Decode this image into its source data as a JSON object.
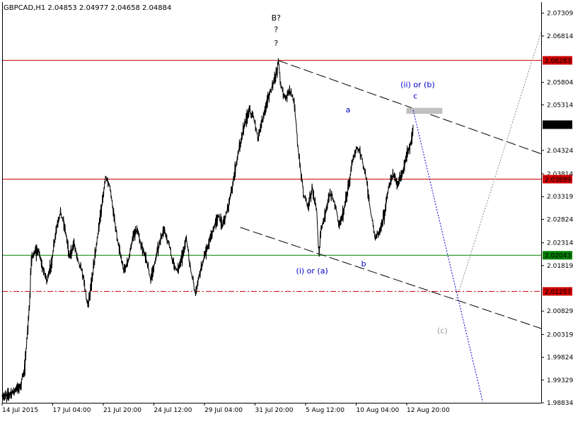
{
  "chart_data": {
    "type": "line",
    "title": "GBPCAD,H1  2.04853 2.04977 2.04658 2.04884",
    "xlabel": "",
    "ylabel": "",
    "ylim": [
      1.98834,
      2.0755
    ],
    "y_ticks": [
      "2.07309",
      "2.06814",
      "2.05804",
      "2.05314",
      "2.04324",
      "2.03814",
      "2.03319",
      "2.02824",
      "2.02314",
      "2.01819",
      "2.00829",
      "2.00319",
      "1.99824",
      "1.99329",
      "1.98834"
    ],
    "x_ticks": [
      "14 Jul 2015",
      "17 Jul 04:00",
      "21 Jul 20:00",
      "24 Jul 12:00",
      "29 Jul 04:00",
      "31 Jul 20:00",
      "5 Aug 12:00",
      "10 Aug 04:00",
      "12 Aug 20:00"
    ],
    "price_path": [
      [
        0,
        1.9895
      ],
      [
        2,
        1.9905
      ],
      [
        4,
        1.992
      ],
      [
        5,
        1.996
      ],
      [
        6,
        2.0085
      ],
      [
        6.5,
        2.02
      ],
      [
        8,
        2.0215
      ],
      [
        9,
        2.0175
      ],
      [
        10,
        2.015
      ],
      [
        11,
        2.019
      ],
      [
        12,
        2.026
      ],
      [
        13,
        2.03
      ],
      [
        14,
        2.026
      ],
      [
        15,
        2.02
      ],
      [
        16,
        2.023
      ],
      [
        17,
        2.019
      ],
      [
        18,
        2.016
      ],
      [
        19,
        2.0095
      ],
      [
        20,
        2.015
      ],
      [
        21,
        2.023
      ],
      [
        22,
        2.03
      ],
      [
        23,
        2.0375
      ],
      [
        24,
        2.035
      ],
      [
        25,
        2.028
      ],
      [
        26,
        2.022
      ],
      [
        27,
        2.017
      ],
      [
        28,
        2.019
      ],
      [
        29,
        2.024
      ],
      [
        30,
        2.026
      ],
      [
        31,
        2.022
      ],
      [
        32,
        2.02
      ],
      [
        33,
        2.015
      ],
      [
        34,
        2.019
      ],
      [
        35,
        2.023
      ],
      [
        36,
        2.026
      ],
      [
        37,
        2.023
      ],
      [
        38,
        2.019
      ],
      [
        39,
        2.017
      ],
      [
        40,
        2.02
      ],
      [
        41,
        2.024
      ],
      [
        42,
        2.017
      ],
      [
        43,
        2.012
      ],
      [
        44,
        2.017
      ],
      [
        45,
        2.02
      ],
      [
        46,
        2.023
      ],
      [
        47,
        2.026
      ],
      [
        48,
        2.029
      ],
      [
        49,
        2.027
      ],
      [
        50,
        2.03
      ],
      [
        51,
        2.034
      ],
      [
        52,
        2.04
      ],
      [
        53,
        2.045
      ],
      [
        54,
        2.049
      ],
      [
        55,
        2.052
      ],
      [
        56,
        2.05
      ],
      [
        57,
        2.046
      ],
      [
        58,
        2.05
      ],
      [
        59,
        2.054
      ],
      [
        60,
        2.057
      ],
      [
        61,
        2.06
      ],
      [
        61.5,
        2.0628
      ],
      [
        62,
        2.0575
      ],
      [
        63,
        2.0545
      ],
      [
        64,
        2.0565
      ],
      [
        65,
        2.0535
      ],
      [
        66,
        2.042
      ],
      [
        67,
        2.034
      ],
      [
        68,
        2.031
      ],
      [
        69,
        2.035
      ],
      [
        70,
        2.03
      ],
      [
        70.5,
        2.0205
      ],
      [
        71,
        2.026
      ],
      [
        72,
        2.03
      ],
      [
        73,
        2.034
      ],
      [
        74,
        2.032
      ],
      [
        75,
        2.027
      ],
      [
        76,
        2.03
      ],
      [
        77,
        2.035
      ],
      [
        78,
        2.041
      ],
      [
        79,
        2.044
      ],
      [
        80,
        2.042
      ],
      [
        81,
        2.037
      ],
      [
        82,
        2.03
      ],
      [
        83,
        2.024
      ],
      [
        84,
        2.026
      ],
      [
        85,
        2.029
      ],
      [
        86,
        2.035
      ],
      [
        87,
        2.038
      ],
      [
        88,
        2.036
      ],
      [
        89,
        2.038
      ],
      [
        90,
        2.042
      ],
      [
        91,
        2.045
      ],
      [
        91.5,
        2.0488
      ]
    ],
    "horizontal_levels": [
      {
        "value": 2.06283,
        "label": "2.06283",
        "color": "#cc0000",
        "style": "solid"
      },
      {
        "value": 2.03699,
        "label": "2.03699",
        "color": "#cc0000",
        "style": "solid"
      },
      {
        "value": 2.02043,
        "label": "2.02043",
        "color": "#008000",
        "style": "solid"
      },
      {
        "value": 2.01257,
        "label": "2.01257",
        "color": "#cc0000",
        "style": "dashdot"
      }
    ],
    "current_price": {
      "value": 2.04884,
      "label": "2.04884"
    },
    "trend_lines": [
      {
        "from": [
          61.5,
          2.0628
        ],
        "to": [
          120,
          2.0425
        ],
        "color": "#000000",
        "style": "dashed"
      },
      {
        "from": [
          53,
          2.0265
        ],
        "to": [
          120,
          2.0045
        ],
        "color": "#000000",
        "style": "dashed"
      }
    ],
    "projections": [
      {
        "from": [
          91.5,
          2.052
        ],
        "to": [
          107,
          1.9885
        ],
        "color": "#0000cc",
        "style": "dotted"
      },
      {
        "from": [
          101,
          2.0105
        ],
        "to": [
          120,
          2.069
        ],
        "color": "#888888",
        "style": "dotted"
      }
    ],
    "target_zone": {
      "x_from": 90,
      "x_to": 98,
      "y_from": 2.0512,
      "y_to": 2.0525,
      "color": "#c0c0c0"
    },
    "annotations": [
      {
        "text": "B?",
        "x": 61,
        "y": 2.0715,
        "color": "#000000"
      },
      {
        "text": "?",
        "x": 61,
        "y": 2.069,
        "color": "#000000"
      },
      {
        "text": "?",
        "x": 61,
        "y": 2.066,
        "color": "#000000"
      },
      {
        "text": "(ii) or (b)",
        "x": 92.5,
        "y": 2.057,
        "color": "#0000cc"
      },
      {
        "text": "c",
        "x": 92,
        "y": 2.0545,
        "color": "#0000cc"
      },
      {
        "text": "a",
        "x": 77,
        "y": 2.0515,
        "color": "#0000cc"
      },
      {
        "text": "b",
        "x": 80.5,
        "y": 2.018,
        "color": "#0000cc"
      },
      {
        "text": "(i) or (a)",
        "x": 69,
        "y": 2.0165,
        "color": "#0000cc"
      },
      {
        "text": "(c)",
        "x": 98,
        "y": 2.0035,
        "color": "#999999"
      }
    ]
  }
}
